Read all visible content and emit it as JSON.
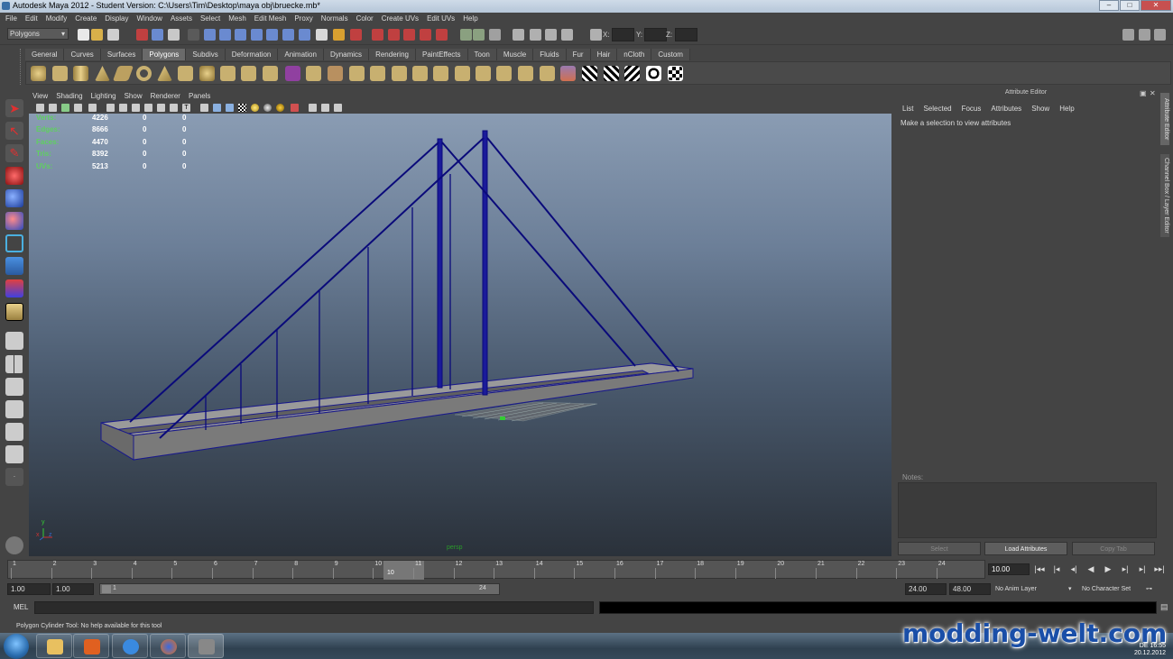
{
  "window": {
    "title": "Autodesk Maya 2012 - Student Version: C:\\Users\\Tim\\Desktop\\maya obj\\bruecke.mb*",
    "controls": [
      "–",
      "□",
      "✕"
    ]
  },
  "menubar": [
    "File",
    "Edit",
    "Modify",
    "Create",
    "Display",
    "Window",
    "Assets",
    "Select",
    "Mesh",
    "Edit Mesh",
    "Proxy",
    "Normals",
    "Color",
    "Create UVs",
    "Edit UVs",
    "Help"
  ],
  "statusline": {
    "mode": "Polygons",
    "x_label": "X:",
    "y_label": "Y:",
    "z_label": "Z:"
  },
  "shelf": {
    "tabs": [
      "General",
      "Curves",
      "Surfaces",
      "Polygons",
      "Subdivs",
      "Deformation",
      "Animation",
      "Dynamics",
      "Rendering",
      "PaintEffects",
      "Toon",
      "Muscle",
      "Fluids",
      "Fur",
      "Hair",
      "nCloth",
      "Custom"
    ],
    "active_tab": "Polygons"
  },
  "panel": {
    "menus": [
      "View",
      "Shading",
      "Lighting",
      "Show",
      "Renderer",
      "Panels"
    ],
    "camera": "persp"
  },
  "hud": {
    "rows": [
      {
        "label": "Verts:",
        "v1": "4226",
        "v2": "0",
        "v3": "0"
      },
      {
        "label": "Edges:",
        "v1": "8666",
        "v2": "0",
        "v3": "0"
      },
      {
        "label": "Faces:",
        "v1": "4470",
        "v2": "0",
        "v3": "0"
      },
      {
        "label": "Tris:",
        "v1": "8392",
        "v2": "0",
        "v3": "0"
      },
      {
        "label": "UVs:",
        "v1": "5213",
        "v2": "0",
        "v3": "0"
      }
    ]
  },
  "axis": {
    "x": "x",
    "y": "y",
    "z": "z"
  },
  "attribute_editor": {
    "title": "Attribute Editor",
    "menu": [
      "List",
      "Selected",
      "Focus",
      "Attributes",
      "Show",
      "Help"
    ],
    "message": "Make a selection to view attributes",
    "notes_label": "Notes:",
    "buttons": {
      "select": "Select",
      "load": "Load Attributes",
      "copy": "Copy Tab"
    }
  },
  "side_tabs": {
    "attribute": "Attribute Editor",
    "channel": "Channel Box / Layer Editor"
  },
  "timeline": {
    "ticks": [
      "1",
      "2",
      "3",
      "4",
      "5",
      "6",
      "7",
      "8",
      "9",
      "10",
      "11",
      "12",
      "13",
      "14",
      "15",
      "16",
      "17",
      "18",
      "19",
      "20",
      "21",
      "22",
      "23",
      "24"
    ],
    "current_frame_marker": "10",
    "current_frame": "10.00",
    "current_frame_value": 10
  },
  "range": {
    "start": "1.00",
    "anim_start": "1.00",
    "slider_start": "1",
    "slider_end": "24",
    "anim_end": "24.00",
    "end": "48.00",
    "anim_layer": "No Anim Layer",
    "character_set": "No Character Set"
  },
  "command": {
    "mel_label": "MEL",
    "help_line": "Polygon Cylinder Tool: No help available for this tool"
  },
  "taskbar": {
    "apps": [
      "explorer-icon",
      "media-player-icon",
      "internet-explorer-icon",
      "firefox-icon",
      "maya-icon"
    ],
    "tray_lang": "DE",
    "clock_time": "16:55",
    "clock_date": "20.12.2012"
  },
  "watermark": "modding-welt.com",
  "colors": {
    "bridge_wire": "#0a0a7a",
    "bridge_fill": "#8a8a8a",
    "viewport_top": "#8a9cb3",
    "viewport_bottom": "#2a313a",
    "hud_label": "#5fd05f",
    "watermark": "#1a4fa8"
  }
}
